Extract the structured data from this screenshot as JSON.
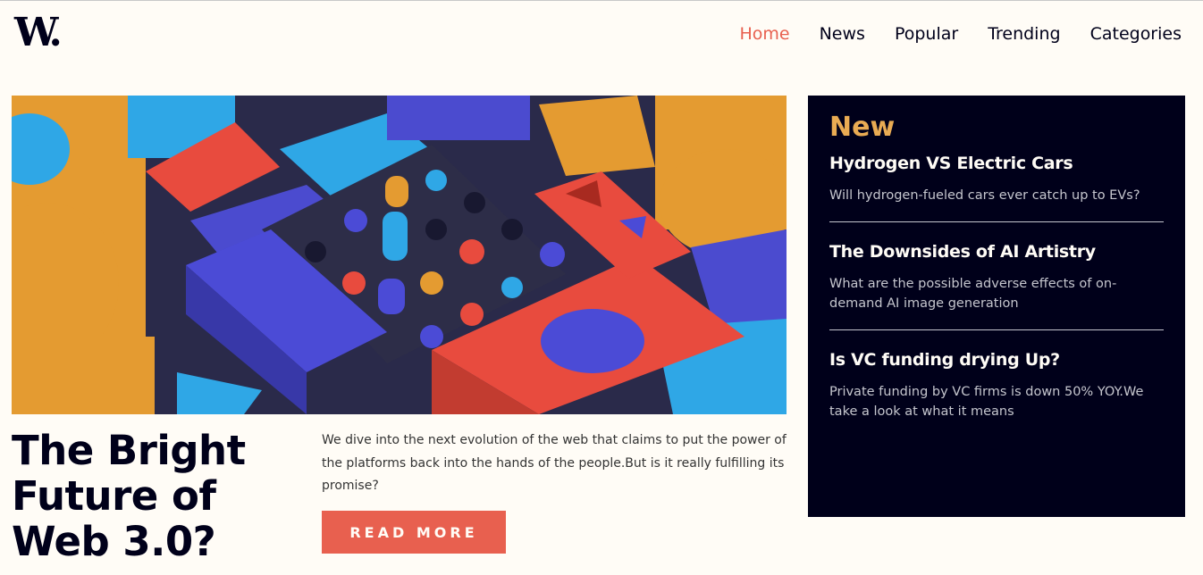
{
  "header": {
    "logo": "W.",
    "nav": [
      "Home",
      "News",
      "Popular",
      "Trending",
      "Categories"
    ],
    "active_nav": "Home"
  },
  "main": {
    "image_alt": "abstract colorful 3D blocks",
    "headline": "The Bright Future of Web 3.0?",
    "lead": "We dive into the next evolution of the web that claims to put the power of the platforms back into the hands of the people.But is it really fulfilling its promise?",
    "cta": "READ MORE"
  },
  "sidebar": {
    "title": "New",
    "items": [
      {
        "title": "Hydrogen VS Electric Cars",
        "text": "Will hydrogen-fueled cars ever catch up to EVs?"
      },
      {
        "title": "The Downsides of AI Artistry",
        "text": "What are the possible adverse effects of on-demand AI image generation"
      },
      {
        "title": "Is VC funding drying Up?",
        "text": "Private funding by VC firms is down 50% YOY.We take a look at what it means"
      }
    ]
  },
  "colors": {
    "accent": "#e8604f",
    "dark": "#00001a",
    "highlight": "#e9ab53",
    "background": "#fffcf6"
  }
}
